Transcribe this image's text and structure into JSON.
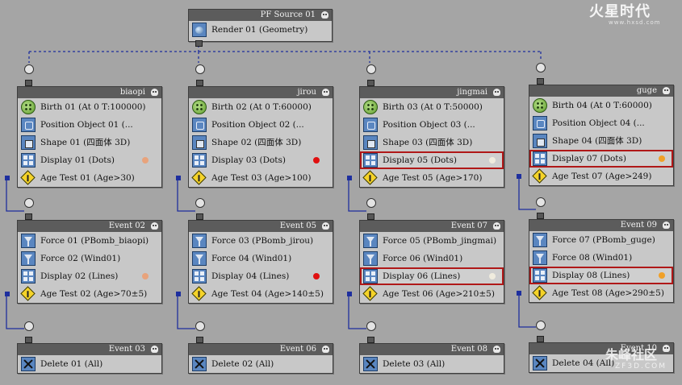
{
  "colors": {
    "canvas": "#a5a5a5",
    "wire": "#1e2f9e",
    "highlight": "#b01818",
    "dot_orange_soft": "#e8a37c",
    "dot_red": "#e01010",
    "dot_white": "#f0ecde",
    "dot_orange": "#f0a028"
  },
  "source": {
    "title": "PF Source 01",
    "render_label": "Render 01 (Geometry)"
  },
  "events": [
    {
      "title": "biaopi",
      "ops": [
        {
          "icon": "birth-icon",
          "label": "Birth 01 (At 0 T:100000)"
        },
        {
          "icon": "position-icon",
          "label": "Position Object 01 (..."
        },
        {
          "icon": "shape-icon",
          "label": "Shape 01 (四面体 3D)"
        },
        {
          "icon": "display-icon",
          "label": "Display 01 (Dots)",
          "dot": "#e8a37c"
        },
        {
          "icon": "test-icon",
          "label": "Age Test 01 (Age>30)"
        }
      ]
    },
    {
      "title": "jirou",
      "ops": [
        {
          "icon": "birth-icon",
          "label": "Birth 02 (At 0 T:60000)"
        },
        {
          "icon": "position-icon",
          "label": "Position Object 02 (..."
        },
        {
          "icon": "shape-icon",
          "label": "Shape 02 (四面体 3D)"
        },
        {
          "icon": "display-icon",
          "label": "Display 03 (Dots)",
          "dot": "#e01010"
        },
        {
          "icon": "test-icon",
          "label": "Age Test 03 (Age>100)"
        }
      ]
    },
    {
      "title": "jingmai",
      "ops": [
        {
          "icon": "birth-icon",
          "label": "Birth 03 (At 0 T:50000)"
        },
        {
          "icon": "position-icon",
          "label": "Position Object 03 (..."
        },
        {
          "icon": "shape-icon",
          "label": "Shape 03 (四面体 3D)"
        },
        {
          "icon": "display-icon",
          "label": "Display 05 (Dots)",
          "dot": "#f0ecde",
          "highlight": true
        },
        {
          "icon": "test-icon",
          "label": "Age Test 05 (Age>170)"
        }
      ]
    },
    {
      "title": "guge",
      "ops": [
        {
          "icon": "birth-icon",
          "label": "Birth 04 (At 0 T:60000)"
        },
        {
          "icon": "position-icon",
          "label": "Position Object 04 (..."
        },
        {
          "icon": "shape-icon",
          "label": "Shape 04 (四面体 3D)"
        },
        {
          "icon": "display-icon",
          "label": "Display 07 (Dots)",
          "dot": "#f0a028",
          "highlight": true
        },
        {
          "icon": "test-icon",
          "label": "Age Test 07 (Age>249)"
        }
      ]
    },
    {
      "title": "Event 02",
      "ops": [
        {
          "icon": "force-icon",
          "label": "Force 01 (PBomb_biaopi)"
        },
        {
          "icon": "force-icon",
          "label": "Force 02 (Wind01)"
        },
        {
          "icon": "display-icon",
          "label": "Display 02 (Lines)",
          "dot": "#e8a37c"
        },
        {
          "icon": "test-icon",
          "label": "Age Test 02 (Age>70±5)"
        }
      ]
    },
    {
      "title": "Event 05",
      "ops": [
        {
          "icon": "force-icon",
          "label": "Force 03 (PBomb_jirou)"
        },
        {
          "icon": "force-icon",
          "label": "Force 04 (Wind01)"
        },
        {
          "icon": "display-icon",
          "label": "Display 04 (Lines)",
          "dot": "#e01010"
        },
        {
          "icon": "test-icon",
          "label": "Age Test 04 (Age>140±5)"
        }
      ]
    },
    {
      "title": "Event 07",
      "ops": [
        {
          "icon": "force-icon",
          "label": "Force 05 (PBomb_jingmai)"
        },
        {
          "icon": "force-icon",
          "label": "Force 06 (Wind01)"
        },
        {
          "icon": "display-icon",
          "label": "Display 06 (Lines)",
          "dot": "#f0ecde",
          "highlight": true
        },
        {
          "icon": "test-icon",
          "label": "Age Test 06 (Age>210±5)"
        }
      ]
    },
    {
      "title": "Event 09",
      "ops": [
        {
          "icon": "force-icon",
          "label": "Force 07 (PBomb_guge)"
        },
        {
          "icon": "force-icon",
          "label": "Force 08 (Wind01)"
        },
        {
          "icon": "display-icon",
          "label": "Display 08 (Lines)",
          "dot": "#f0a028",
          "highlight": true
        },
        {
          "icon": "test-icon",
          "label": "Age Test 08 (Age>290±5)"
        }
      ]
    },
    {
      "title": "Event 03",
      "ops": [
        {
          "icon": "delete-icon",
          "label": "Delete 01 (All)"
        }
      ]
    },
    {
      "title": "Event 06",
      "ops": [
        {
          "icon": "delete-icon",
          "label": "Delete 02 (All)"
        }
      ]
    },
    {
      "title": "Event 08",
      "ops": [
        {
          "icon": "delete-icon",
          "label": "Delete 03 (All)"
        }
      ]
    },
    {
      "title": "Event 10",
      "ops": [
        {
          "icon": "delete-icon",
          "label": "Delete 04 (All)"
        }
      ]
    }
  ],
  "watermark_top": {
    "main": "火星时代",
    "sub": "www.hxsd.com"
  },
  "watermark_bottom": {
    "main": "朱峰社区",
    "sub": "ZF3D.COM"
  }
}
